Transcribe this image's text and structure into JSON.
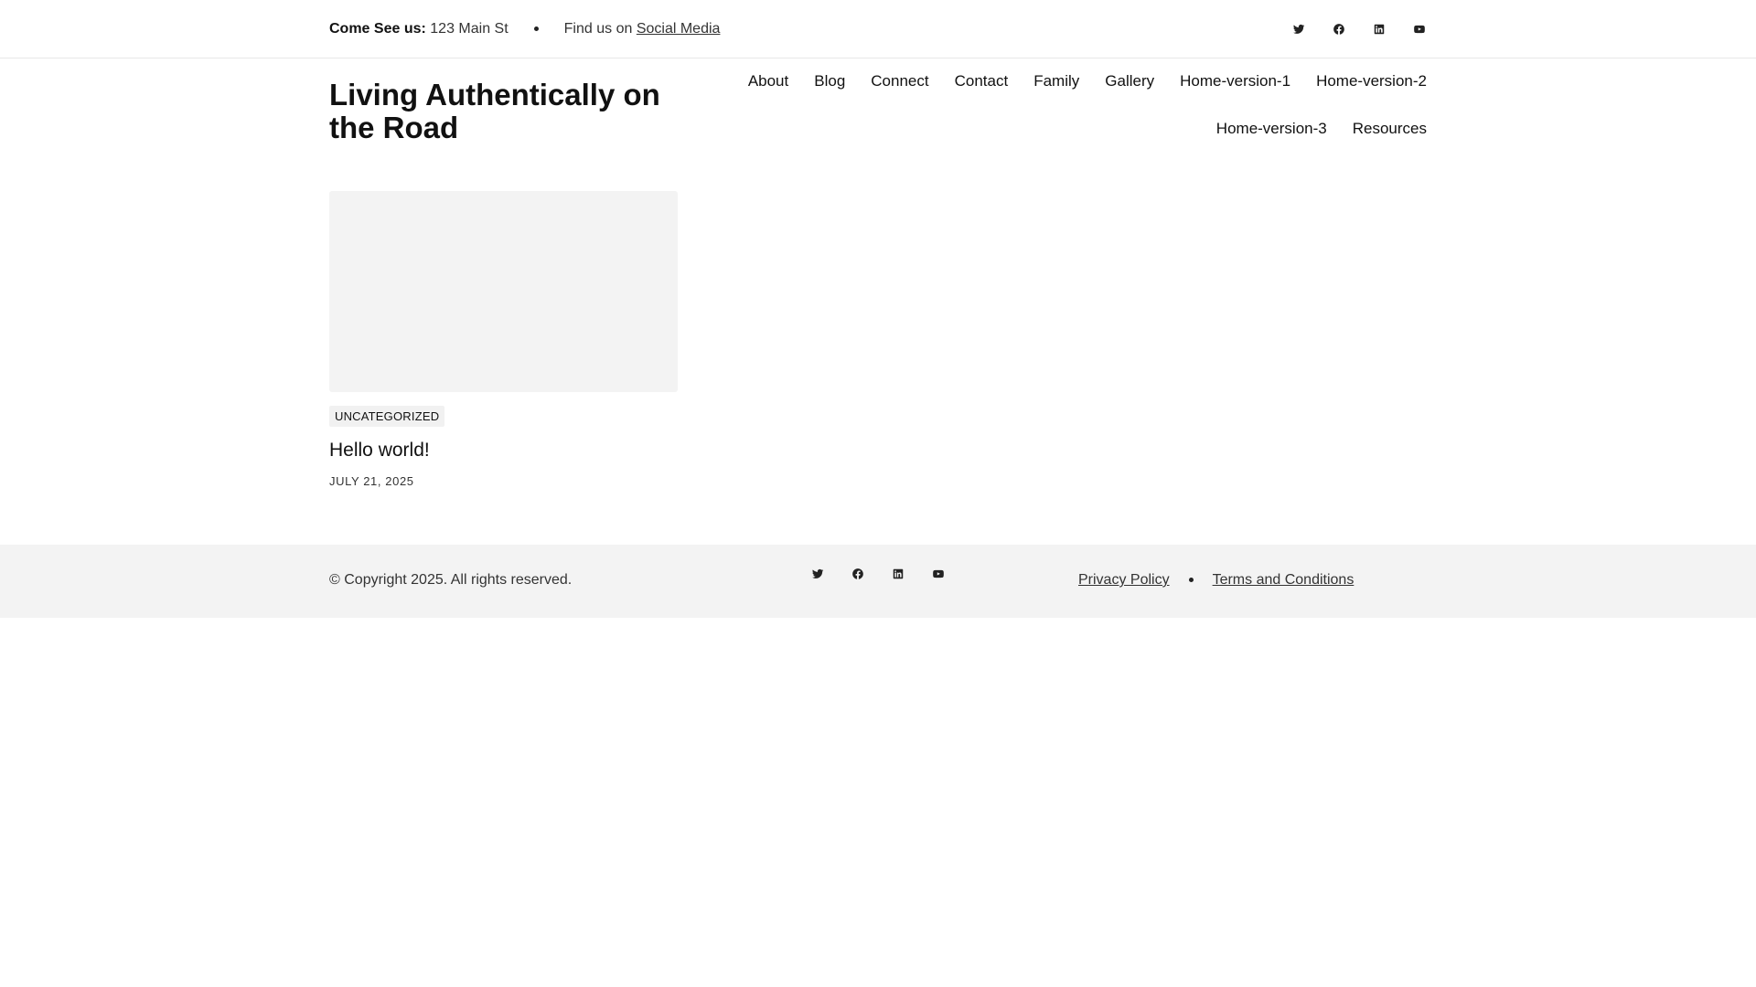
{
  "topbar": {
    "address_label": "Come See us:",
    "address_value": "123 Main St",
    "social_prefix": "Find us on",
    "social_link": "Social Media",
    "icons": [
      "twitter-icon",
      "facebook-icon",
      "linkedin-icon",
      "youtube-icon"
    ]
  },
  "header": {
    "site_title": "Living Authentically on the Road",
    "nav": [
      "About",
      "Blog",
      "Connect",
      "Contact",
      "Family",
      "Gallery",
      "Home-version-1",
      "Home-version-2",
      "Home-version-3",
      "Resources"
    ]
  },
  "post": {
    "category": "UNCATEGORIZED",
    "title": "Hello world!",
    "date": "JULY 21, 2025"
  },
  "footer": {
    "copyright": "© Copyright 2025. All rights reserved.",
    "icons": [
      "twitter-icon",
      "facebook-icon",
      "linkedin-icon",
      "youtube-icon"
    ],
    "links": [
      "Privacy Policy",
      "Terms and Conditions"
    ]
  },
  "colors": {
    "text": "#111111",
    "muted": "#333333",
    "footer_bg": "#f3f3f3",
    "thumb_bg": "#f3f3f3"
  }
}
